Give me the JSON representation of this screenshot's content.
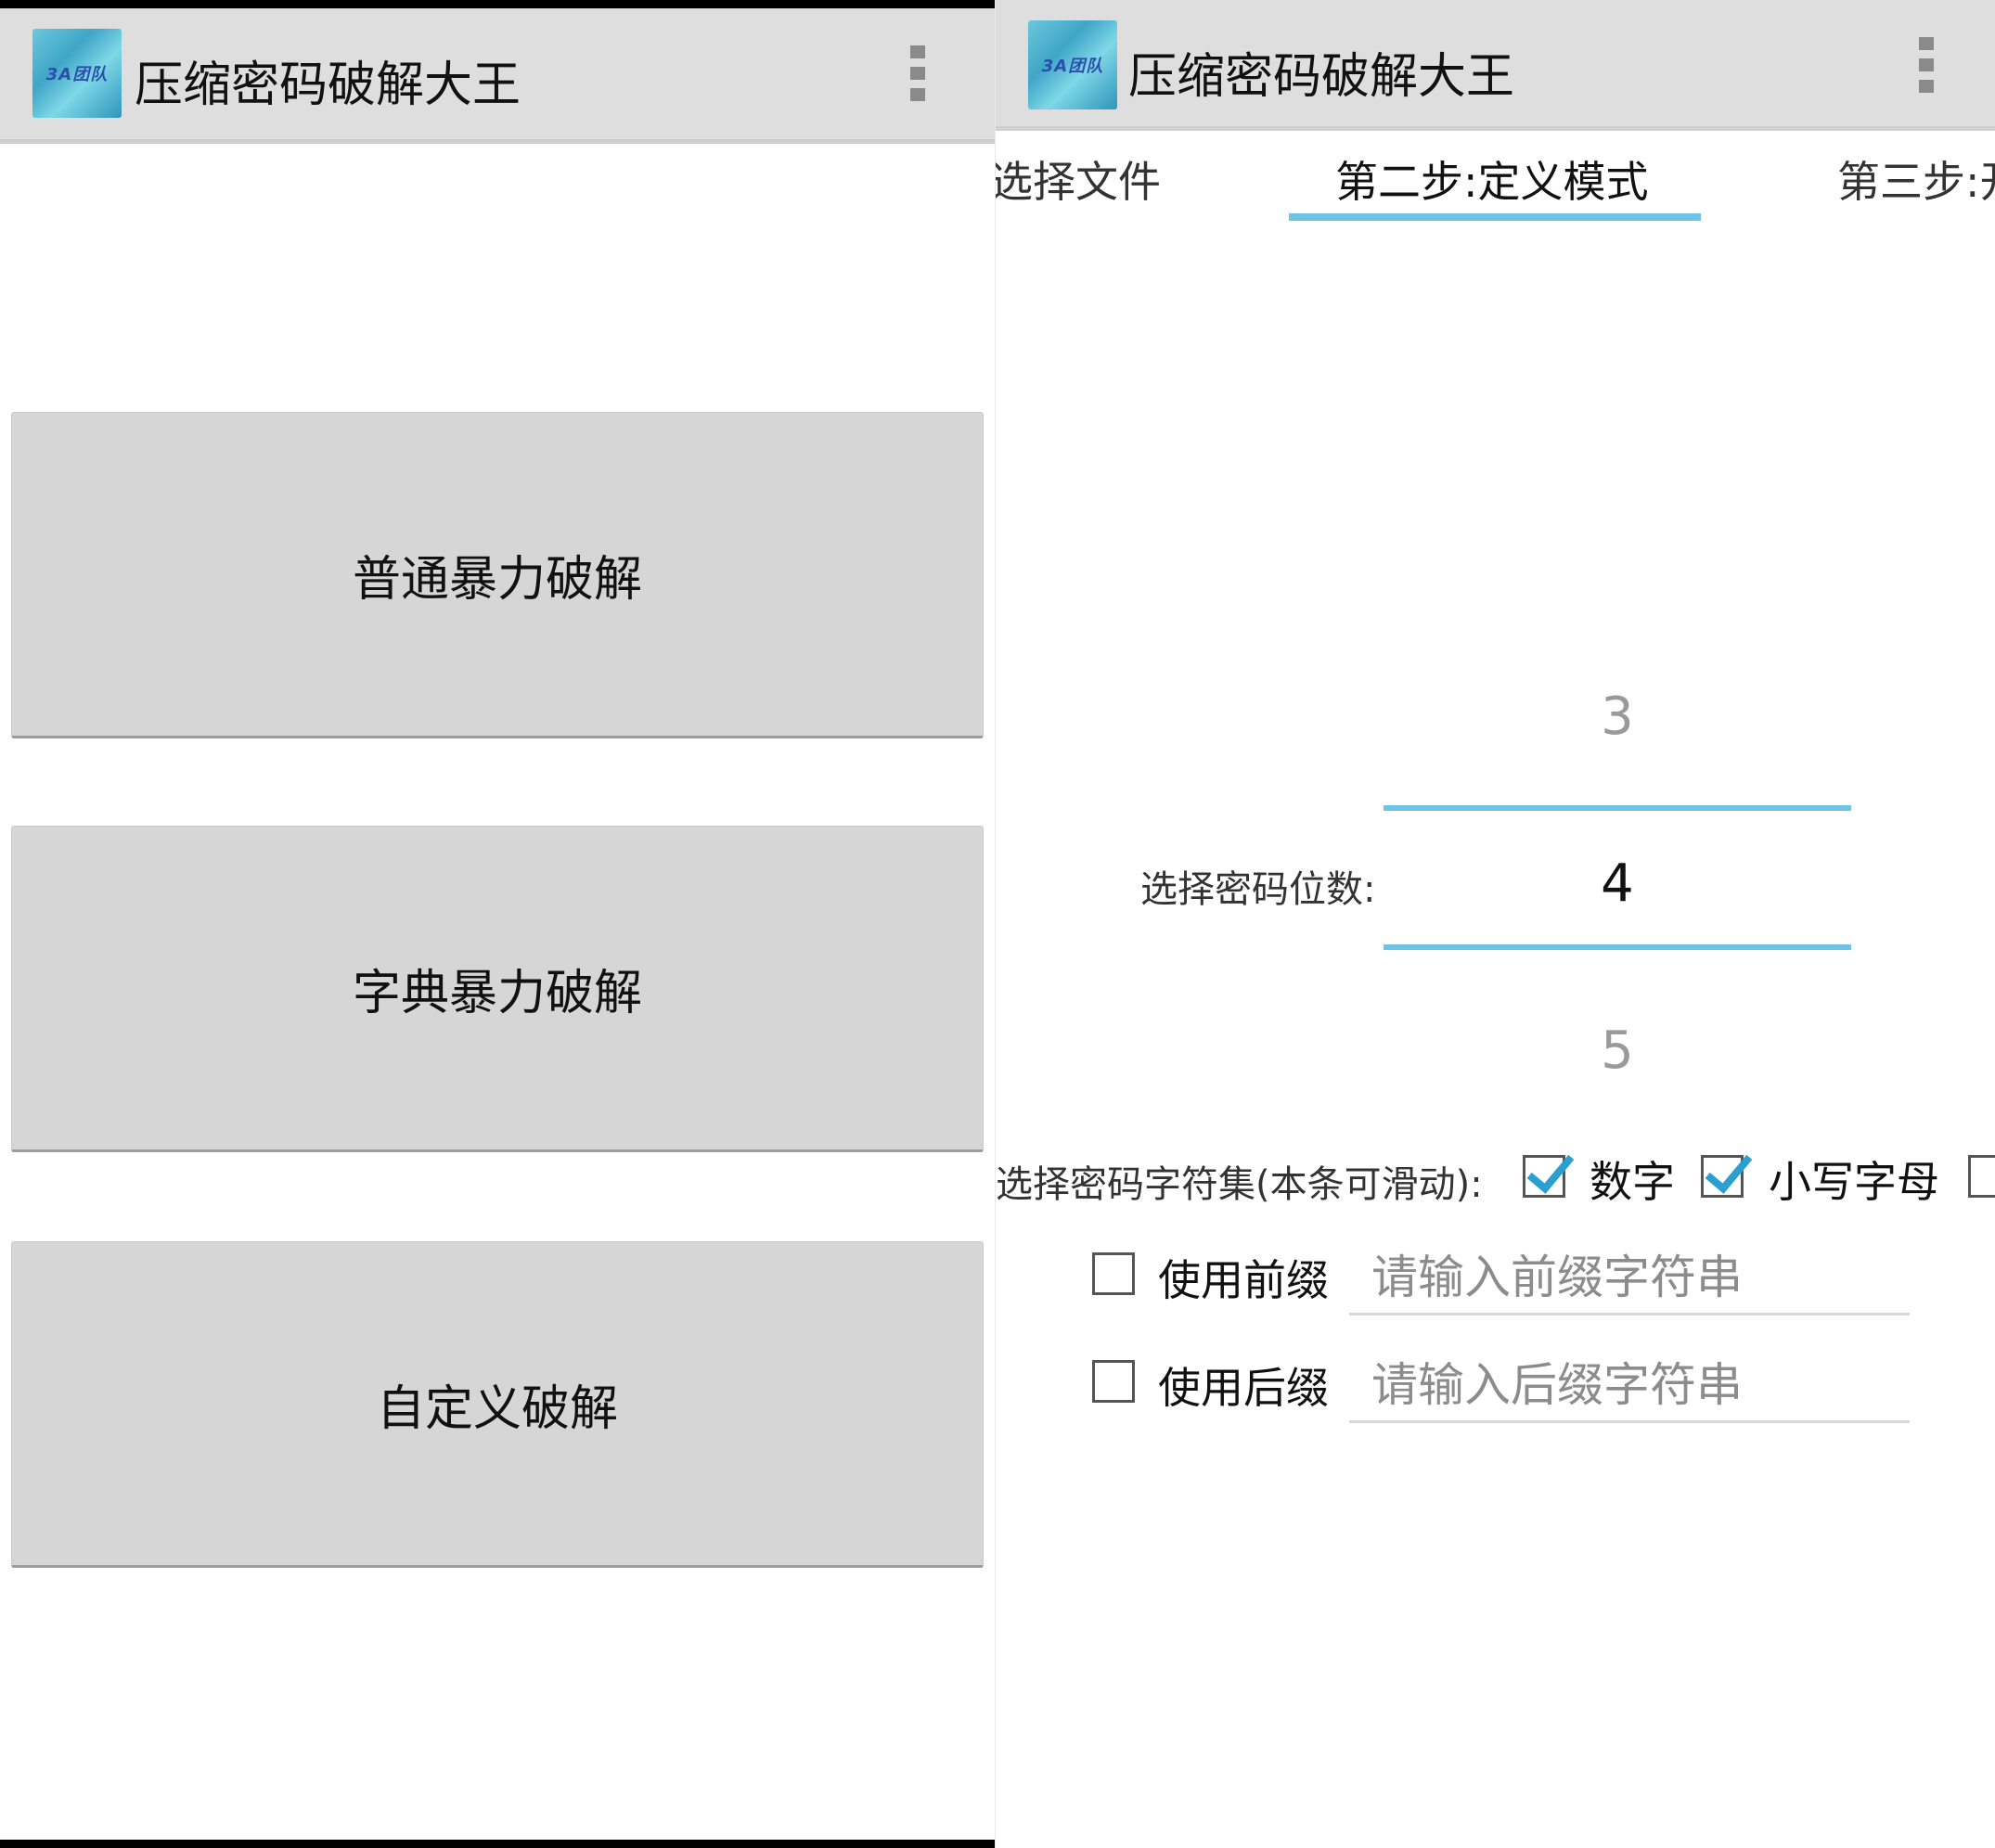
{
  "left": {
    "app_title": "压缩密码破解大王",
    "logo_text": "3A团队",
    "buttons": [
      {
        "label": "普通暴力破解"
      },
      {
        "label": "字典暴力破解"
      },
      {
        "label": "自定义破解"
      }
    ]
  },
  "right": {
    "app_title": "压缩密码破解大王",
    "logo_text": "3A团队",
    "tabs": [
      {
        "label": "选择文件"
      },
      {
        "label": "第二步:定义模式",
        "selected": true
      },
      {
        "label": "第三步:开"
      }
    ],
    "length_label": "选择密码位数:",
    "picker": {
      "prev": "3",
      "current": "4",
      "next": "5"
    },
    "charset_label": "选择密码字符集(本条可滑动):",
    "charset_options": [
      {
        "label": "数字",
        "checked": true
      },
      {
        "label": "小写字母",
        "checked": true
      },
      {
        "label": "",
        "checked": false
      }
    ],
    "prefix": {
      "label": "使用前缀",
      "checked": false,
      "placeholder": "请输入前缀字符串",
      "value": ""
    },
    "suffix": {
      "label": "使用后缀",
      "checked": false,
      "placeholder": "请输入后缀字符串",
      "value": ""
    }
  }
}
